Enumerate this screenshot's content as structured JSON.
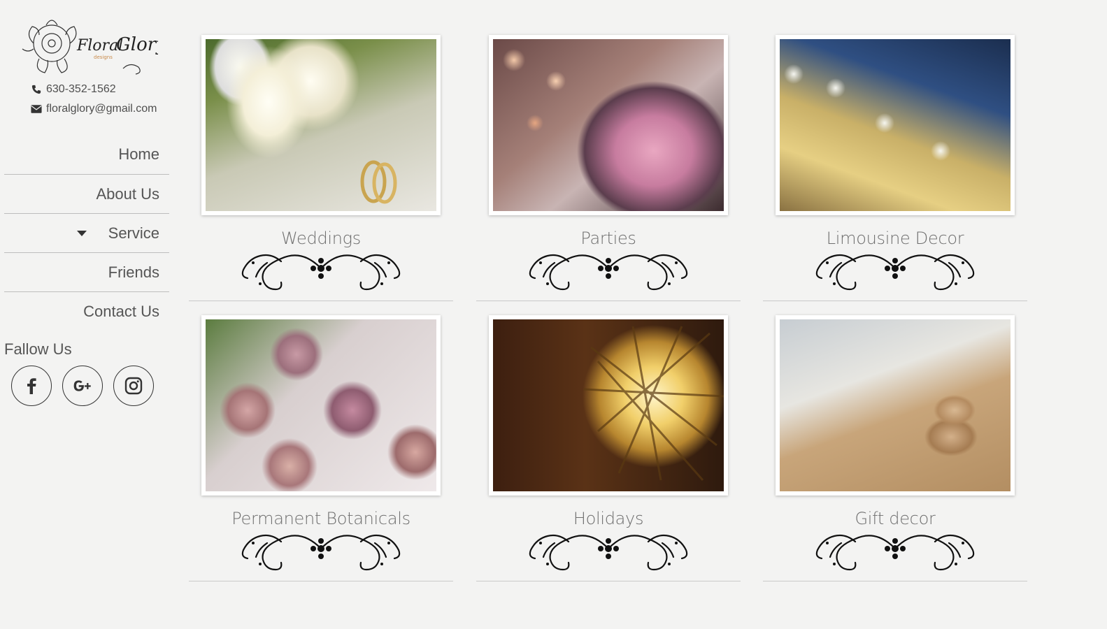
{
  "brand": {
    "logo_alt": "Floral Glory designs"
  },
  "contact": {
    "phone": "630-352-1562",
    "email": "floralglory@gmail.com"
  },
  "nav": {
    "items": [
      {
        "label": "Home"
      },
      {
        "label": "About Us"
      },
      {
        "label": "Service"
      },
      {
        "label": "Friends"
      },
      {
        "label": "Contact Us"
      }
    ]
  },
  "follow": {
    "label": "Fallow Us",
    "icons": [
      "facebook-icon",
      "google-plus-icon",
      "instagram-icon"
    ]
  },
  "gallery": {
    "items": [
      {
        "caption": "Weddings"
      },
      {
        "caption": "Parties"
      },
      {
        "caption": "Limousine Decor"
      },
      {
        "caption": "Permanent Botanicals"
      },
      {
        "caption": "Holidays"
      },
      {
        "caption": "Gift decor"
      }
    ]
  },
  "colors": {
    "background": "#f3f3f2",
    "text": "#555555",
    "divider": "#bdbdbd"
  }
}
